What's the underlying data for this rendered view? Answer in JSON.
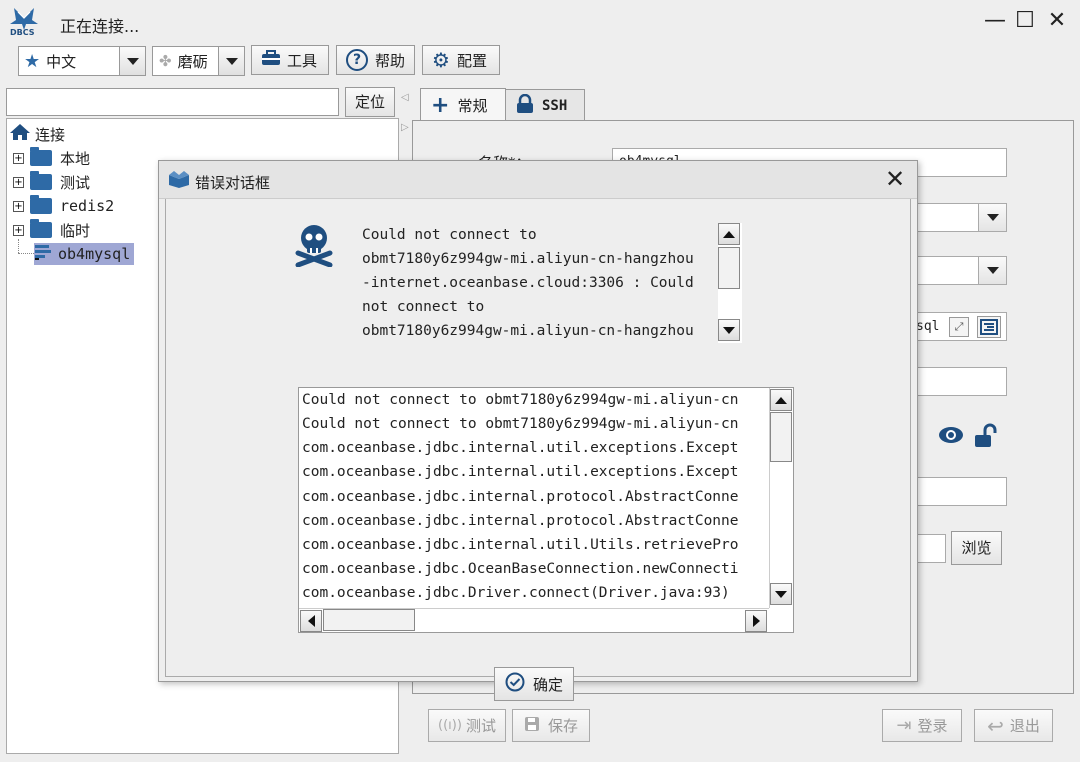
{
  "window": {
    "logo_text": "DBCS",
    "title": "正在连接...",
    "minimize": "—",
    "maximize": "☐",
    "close": "✕"
  },
  "toolbar": {
    "language": "中文",
    "theme": "磨砺",
    "tools": "工具",
    "help": "帮助",
    "config": "配置"
  },
  "search": {
    "value": "",
    "locate": "定位"
  },
  "tree": {
    "root": "连接",
    "items": [
      {
        "label": "本地"
      },
      {
        "label": "测试"
      },
      {
        "label": "redis2"
      },
      {
        "label": "临时"
      }
    ],
    "selected": "ob4mysql"
  },
  "tabs": {
    "general": "常规",
    "ssh": "SSH"
  },
  "form": {
    "name_label": "名称*：",
    "name_fragment": "ob4mysql",
    "partial_text": "sql",
    "browse": "浏览"
  },
  "bottom": {
    "test": "测试",
    "save": "保存",
    "login": "登录",
    "exit": "退出"
  },
  "dialog": {
    "title": "错误对话框",
    "close": "✕",
    "message_lines": [
      "Could not connect to",
      "obmt7180y6z994gw-mi.aliyun-cn-hangzhou",
      "-internet.oceanbase.cloud:3306 : Could",
      "not connect to",
      "obmt7180y6z994gw-mi.aliyun-cn-hangzhou"
    ],
    "trace_lines": [
      "Could not connect to obmt7180y6z994gw-mi.aliyun-cn",
      "Could not connect to obmt7180y6z994gw-mi.aliyun-cn",
      "com.oceanbase.jdbc.internal.util.exceptions.Except",
      "com.oceanbase.jdbc.internal.util.exceptions.Except",
      "com.oceanbase.jdbc.internal.protocol.AbstractConne",
      "com.oceanbase.jdbc.internal.protocol.AbstractConne",
      "com.oceanbase.jdbc.internal.util.Utils.retrievePro",
      "com.oceanbase.jdbc.OceanBaseConnection.newConnecti",
      "com.oceanbase.jdbc.Driver.connect(Driver.java:93)"
    ],
    "ok": "确定"
  },
  "colors": {
    "accent": "#2e6aa6",
    "icon_dark": "#1f4e80"
  }
}
